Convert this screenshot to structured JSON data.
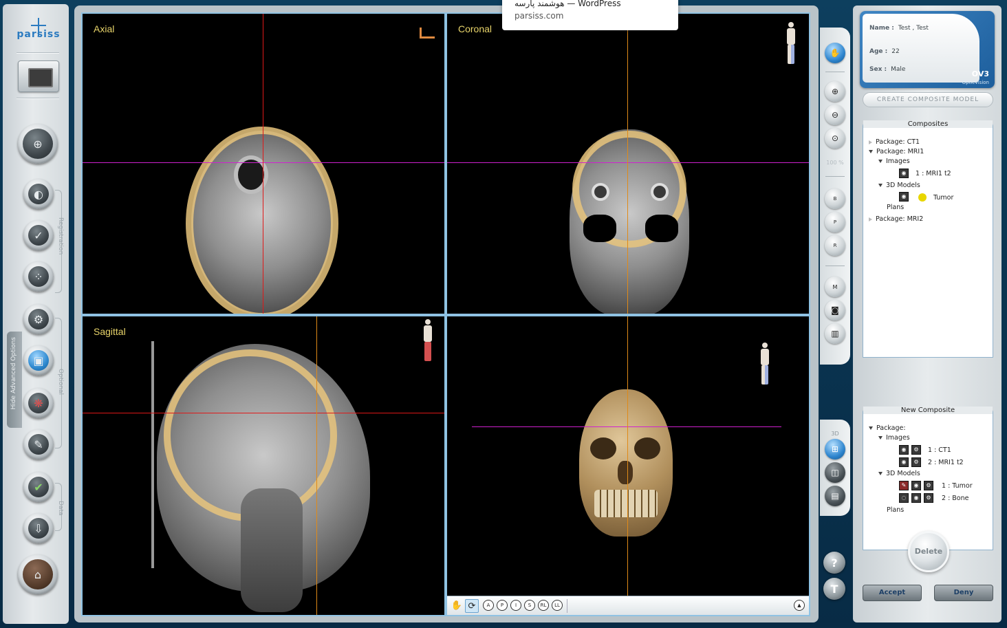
{
  "tooltip": {
    "title": "هوشمند پارسه — WordPress",
    "url": "parsiss.com"
  },
  "sidebar": {
    "logo": "parsiss",
    "section_registration": "Registration",
    "section_optional": "Optional",
    "section_data": "Data",
    "advanced_tab": "Hide Advanced Options"
  },
  "viewer": {
    "axial_label": "Axial",
    "coronal_label": "Coronal",
    "sagittal_label": "Sagittal",
    "toolbar": [
      "A",
      "P",
      "I",
      "S",
      "RL",
      "LL"
    ]
  },
  "tools": {
    "zoom_text": "100 %",
    "window_b": "B",
    "window_p": "P",
    "window_r": "R",
    "measure": "M",
    "section_3d": "3D",
    "help": "?"
  },
  "patient": {
    "name_label": "Name :",
    "name_value": "Test , Test",
    "age_label": "Age :",
    "age_value": "22",
    "sex_label": "Sex :",
    "sex_value": "Male",
    "brand": "OV3",
    "brand_sub": "OpticVision"
  },
  "composite_button": "CREATE COMPOSITE MODEL",
  "composites": {
    "title": "Composites",
    "package_ct1": "Package: CT1",
    "package_mri1": "Package: MRI1",
    "images": "Images",
    "image_1": "1 : MRI1 t2",
    "models_3d": "3D Models",
    "model_tumor": "Tumor",
    "plans": "Plans",
    "package_mri2": "Package: MRI2"
  },
  "new_composite": {
    "title": "New Composite",
    "package": "Package:",
    "images": "Images",
    "image_1": "1 : CT1",
    "image_2": "2 : MRI1 t2",
    "models_3d": "3D Models",
    "model_1": "1 : Tumor",
    "model_2": "2 : Bone",
    "plans": "Plans"
  },
  "buttons": {
    "delete": "Delete",
    "accept": "Accept",
    "deny": "Deny"
  },
  "colors": {
    "accent": "#2f86cf",
    "pane_label": "#e8d46a",
    "crosshair_red": "#e01818",
    "crosshair_magenta": "#d021d0",
    "crosshair_orange": "#e08a18"
  }
}
